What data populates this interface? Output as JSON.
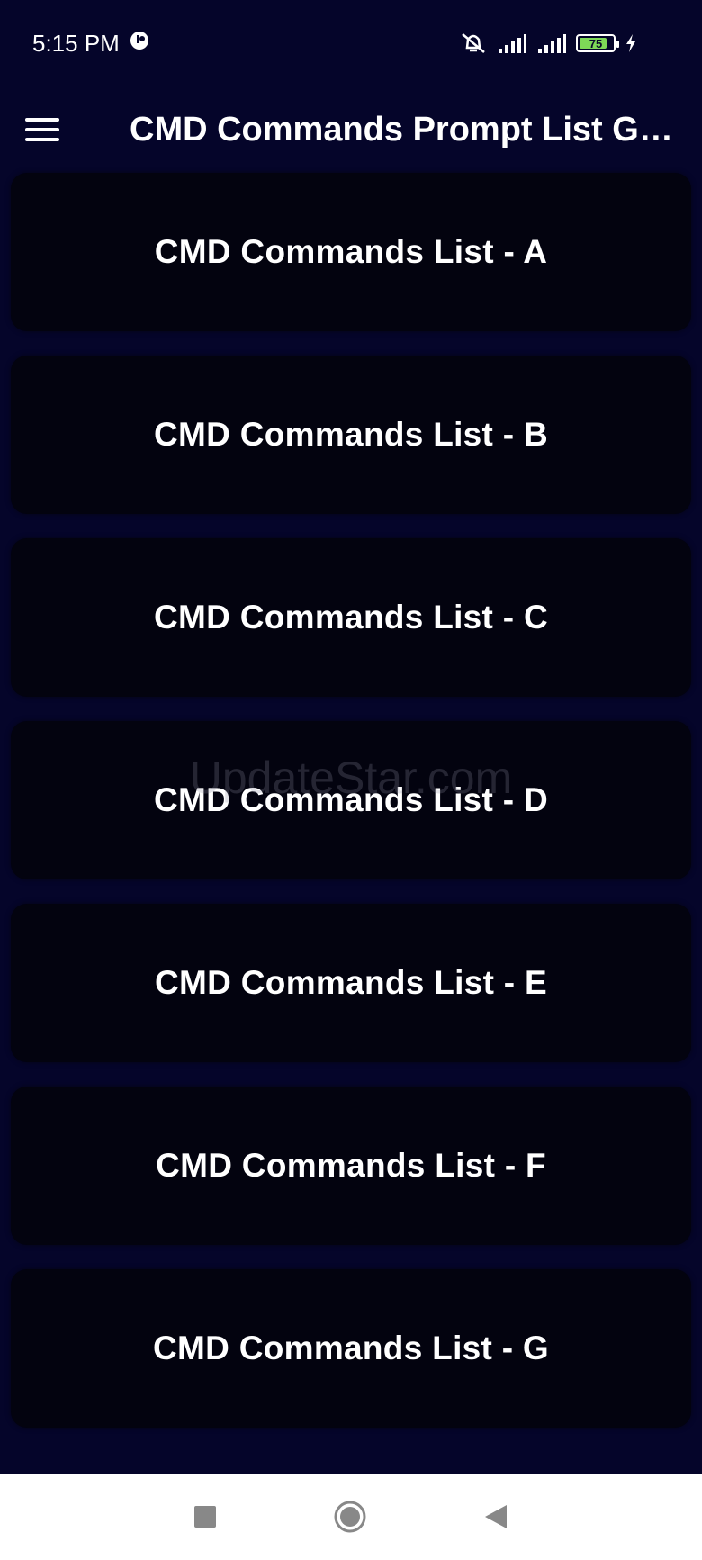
{
  "status_bar": {
    "time": "5:15 PM",
    "battery_level": "75",
    "battery_color": "#7ed957"
  },
  "app_bar": {
    "menu_icon": "hamburger-menu-icon",
    "title": "CMD Commands Prompt List Guide"
  },
  "list": {
    "items": [
      {
        "label": "CMD Commands List - A"
      },
      {
        "label": "CMD Commands List - B"
      },
      {
        "label": "CMD Commands List - C"
      },
      {
        "label": "CMD Commands List - D"
      },
      {
        "label": "CMD Commands List - E"
      },
      {
        "label": "CMD Commands List - F"
      },
      {
        "label": "CMD Commands List - G"
      }
    ]
  },
  "watermark": "UpdateStar.com",
  "nav_bar": {
    "icons": [
      "recent-apps-icon",
      "home-icon",
      "back-icon"
    ]
  },
  "colors": {
    "background": "#05052a",
    "card": "#03030f",
    "text": "#ffffff"
  }
}
